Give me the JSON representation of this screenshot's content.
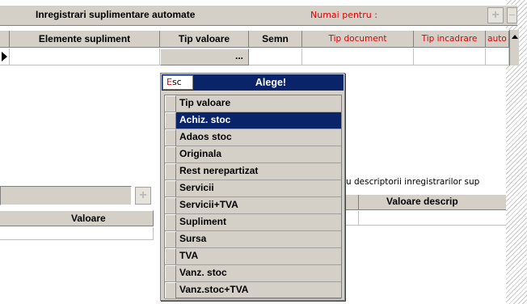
{
  "header": {
    "title": "Inregistrari suplimentare automate",
    "numai_pentru": "Numai pentru :",
    "add_symbol": "+",
    "remove_symbol": "−"
  },
  "grid": {
    "columns": [
      {
        "label": "Elemente supliment",
        "style": "bold"
      },
      {
        "label": "Tip valoare",
        "style": "bold"
      },
      {
        "label": "Semn",
        "style": "bold"
      },
      {
        "label": "Tip document",
        "style": "red"
      },
      {
        "label": "Tip incadrare",
        "style": "red"
      },
      {
        "label": "auto",
        "style": "red"
      }
    ],
    "row_ellipsis": "..."
  },
  "popup": {
    "esc_hotkey": "E",
    "esc_rest": "sc",
    "title": "Alege!",
    "options": [
      {
        "label": "Tip valoare",
        "selected": false
      },
      {
        "label": "Achiz. stoc",
        "selected": true
      },
      {
        "label": "Adaos stoc",
        "selected": false
      },
      {
        "label": "Originala",
        "selected": false
      },
      {
        "label": "Rest nerepartizat",
        "selected": false
      },
      {
        "label": "Servicii",
        "selected": false
      },
      {
        "label": "Servicii+TVA",
        "selected": false
      },
      {
        "label": "Supliment",
        "selected": false
      },
      {
        "label": "Sursa",
        "selected": false
      },
      {
        "label": "TVA",
        "selected": false
      },
      {
        "label": "Vanz. stoc",
        "selected": false
      },
      {
        "label": "Vanz.stoc+TVA",
        "selected": false
      }
    ]
  },
  "lower": {
    "left_column": "Valoare",
    "add_symbol": "+",
    "note": "u descriptorii inregistrarilor sup",
    "right_column": "Valoare descrip"
  },
  "colors": {
    "header_red": "#e00000",
    "selection_blue": "#0a246a",
    "panel_gray": "#d4d0c8"
  }
}
